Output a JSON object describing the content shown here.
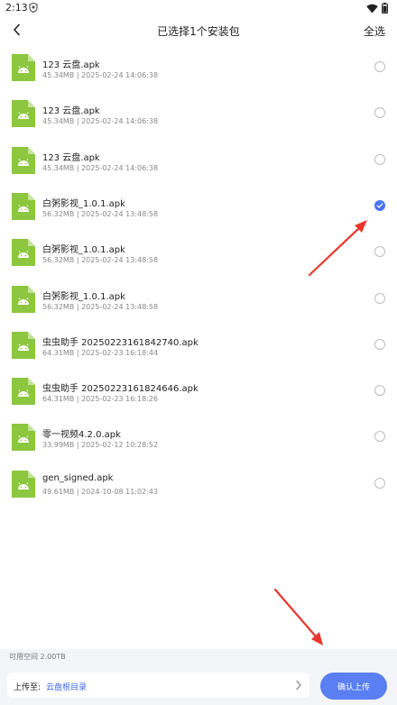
{
  "status_bar": {
    "time": "2:13"
  },
  "header": {
    "title": "已选择1个安装包",
    "select_all": "全选"
  },
  "files": [
    {
      "name": "123 云盘.apk",
      "size": "45.34MB",
      "date": "2025-02-24 14:06:38",
      "checked": false
    },
    {
      "name": "123 云盘.apk",
      "size": "45.34MB",
      "date": "2025-02-24 14:06:38",
      "checked": false
    },
    {
      "name": "123 云盘.apk",
      "size": "45.34MB",
      "date": "2025-02-24 14:06:38",
      "checked": false
    },
    {
      "name": "白粥影视_1.0.1.apk",
      "size": "56.32MB",
      "date": "2025-02-24 13:48:58",
      "checked": true
    },
    {
      "name": "白粥影视_1.0.1.apk",
      "size": "56.32MB",
      "date": "2025-02-24 13:48:58",
      "checked": false
    },
    {
      "name": "白粥影视_1.0.1.apk",
      "size": "56.32MB",
      "date": "2025-02-24 13:48:58",
      "checked": false
    },
    {
      "name": "虫虫助手 20250223161842740.apk",
      "size": "64.31MB",
      "date": "2025-02-23 16:18:44",
      "checked": false
    },
    {
      "name": "虫虫助手 20250223161824646.apk",
      "size": "64.31MB",
      "date": "2025-02-23 16:18:26",
      "checked": false
    },
    {
      "name": "零一视频4.2.0.apk",
      "size": "33.99MB",
      "date": "2025-02-12 10:28:52",
      "checked": false
    },
    {
      "name": "gen_signed.apk",
      "size": "49.61MB",
      "date": "2024-10-08 11:02:43",
      "checked": false
    }
  ],
  "bottom": {
    "available_space": "可用空间 2.00TB",
    "upload_label": "上传至:",
    "upload_target": "云盘根目录",
    "confirm_label": "确认上传"
  },
  "colors": {
    "accent": "#4a72f0",
    "apk_icon": "#8dc63f",
    "annotation_arrow": "#e8382d"
  },
  "icons": [
    "back-arrow-icon",
    "android-apk-icon",
    "radio-checked-icon",
    "chevron-right-icon",
    "wifi-icon",
    "battery-icon",
    "shield-icon"
  ]
}
